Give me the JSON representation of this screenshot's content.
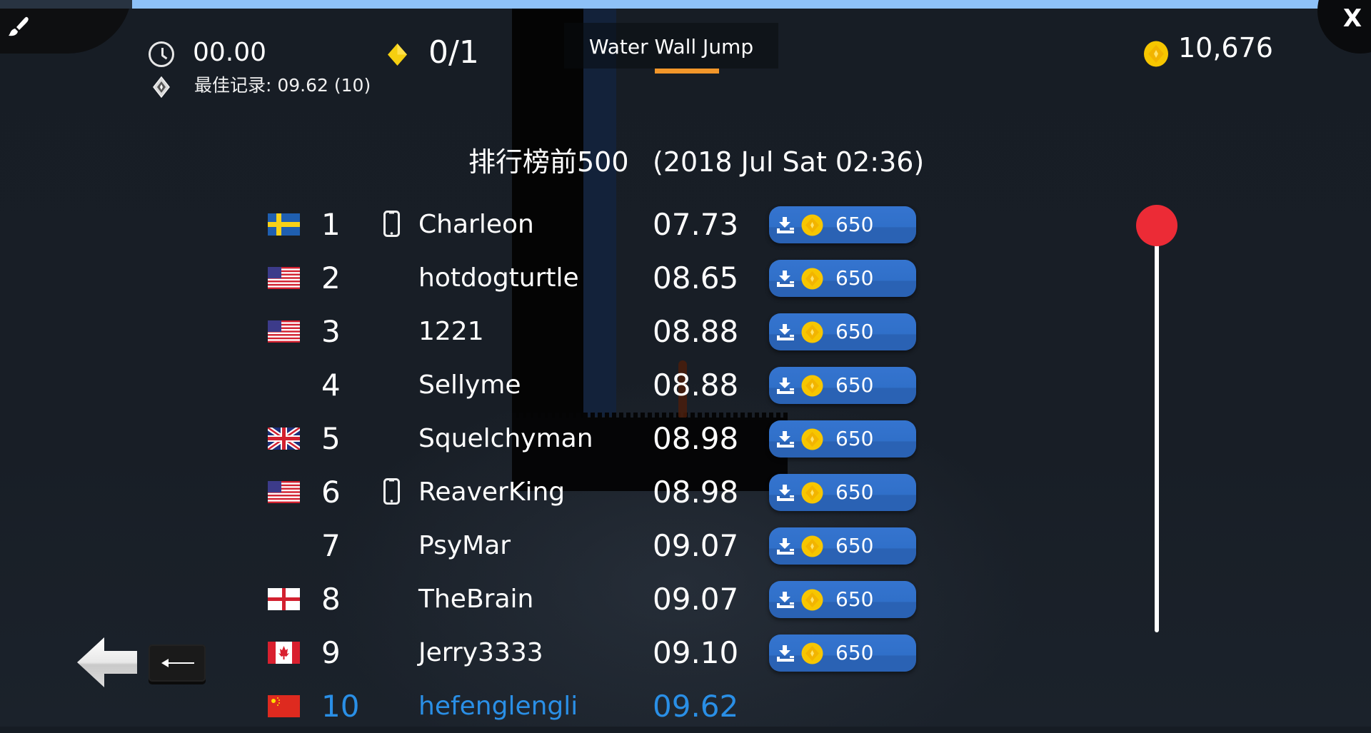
{
  "hud": {
    "timer": "00.00",
    "best_record": "最佳记录: 09.62  (10)",
    "gems": "0/1",
    "level_title": "Water Wall Jump",
    "coin_total": "10,676",
    "close_label": "X"
  },
  "leaderboard": {
    "title": "排行榜前500",
    "date": "(2018 Jul Sat 02:36)",
    "rows": [
      {
        "rank": "1",
        "flag": "sweden",
        "device": "phone",
        "name": "Charleon",
        "time": "07.73",
        "price": "650"
      },
      {
        "rank": "2",
        "flag": "usa",
        "device": "",
        "name": "hotdogturtle",
        "time": "08.65",
        "price": "650"
      },
      {
        "rank": "3",
        "flag": "usa",
        "device": "",
        "name": "1221",
        "time": "08.88",
        "price": "650"
      },
      {
        "rank": "4",
        "flag": "",
        "device": "",
        "name": "Sellyme",
        "time": "08.88",
        "price": "650"
      },
      {
        "rank": "5",
        "flag": "uk",
        "device": "",
        "name": "Squelchyman",
        "time": "08.98",
        "price": "650"
      },
      {
        "rank": "6",
        "flag": "usa",
        "device": "phone",
        "name": "ReaverKing",
        "time": "08.98",
        "price": "650"
      },
      {
        "rank": "7",
        "flag": "",
        "device": "",
        "name": "PsyMar",
        "time": "09.07",
        "price": "650"
      },
      {
        "rank": "8",
        "flag": "england",
        "device": "",
        "name": "TheBrain",
        "time": "09.07",
        "price": "650"
      },
      {
        "rank": "9",
        "flag": "canada",
        "device": "",
        "name": "Jerry3333",
        "time": "09.10",
        "price": "650"
      },
      {
        "rank": "10",
        "flag": "china",
        "device": "",
        "name": "hefenglengli",
        "time": "09.62",
        "price": "",
        "is_current_user": true
      }
    ]
  },
  "scroll": {
    "position_fraction": 0.0
  },
  "colors": {
    "highlight": "#2a8fe6",
    "button_blue": "#3070c9",
    "accent_orange": "#f2962a",
    "scroll_thumb": "#ec2b36",
    "coin_gold": "#f7c600"
  }
}
